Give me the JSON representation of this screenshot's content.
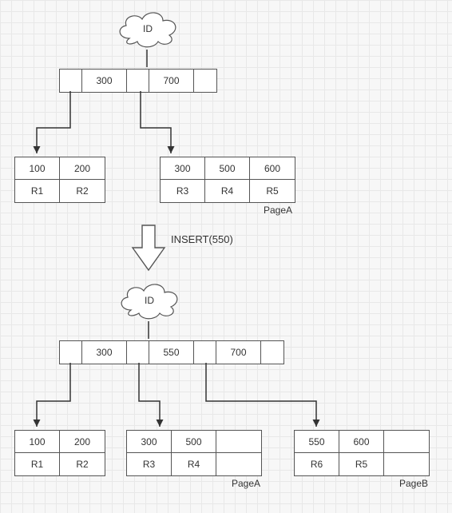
{
  "before": {
    "cloud": "ID",
    "root_keys": [
      "",
      "300",
      "",
      "700",
      ""
    ],
    "leaf_left": {
      "keys": [
        "100",
        "200"
      ],
      "rows": [
        "R1",
        "R2"
      ]
    },
    "leaf_right": {
      "keys": [
        "300",
        "500",
        "600"
      ],
      "rows": [
        "R3",
        "R4",
        "R5"
      ],
      "page": "PageA"
    }
  },
  "operation": "INSERT(550)",
  "after": {
    "cloud": "ID",
    "root_keys": [
      "",
      "300",
      "",
      "550",
      "",
      "700",
      ""
    ],
    "leaf1": {
      "keys": [
        "100",
        "200"
      ],
      "rows": [
        "R1",
        "R2"
      ]
    },
    "leaf2": {
      "keys": [
        "300",
        "500",
        ""
      ],
      "rows": [
        "R3",
        "R4",
        ""
      ],
      "page": "PageA"
    },
    "leaf3": {
      "keys": [
        "550",
        "600",
        ""
      ],
      "rows": [
        "R6",
        "R5",
        ""
      ],
      "page": "PageB"
    }
  }
}
